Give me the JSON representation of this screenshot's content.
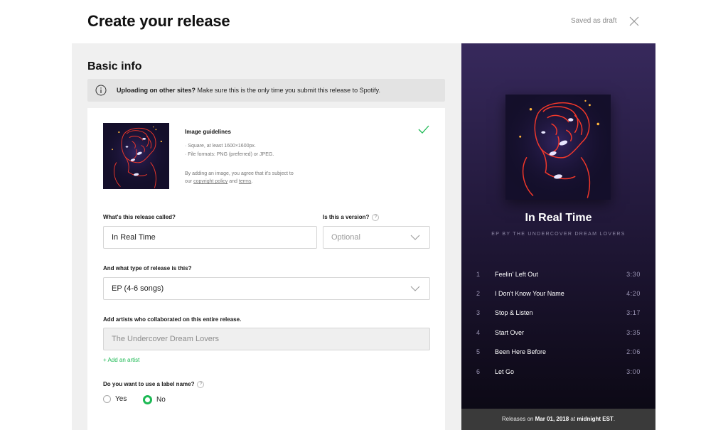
{
  "header": {
    "title": "Create your release",
    "saved_status": "Saved as draft"
  },
  "basic_info": {
    "title": "Basic info",
    "notice": {
      "bold": "Uploading on other sites?",
      "text": " Make sure this is the only time you submit this release to Spotify."
    },
    "image_guidelines": {
      "title": "Image guidelines",
      "line1": "· Square, at least 1600×1600px.",
      "line2": "· File formats: PNG (preferred) or JPEG.",
      "line3": "By adding an image, you agree that it's subject to",
      "line4_prefix": "our ",
      "copyright_link": "copyright policy",
      "line4_mid": " and ",
      "terms_link": "terms",
      "line4_suffix": "."
    },
    "release_name": {
      "label": "What's this release called?",
      "value": "In Real Time"
    },
    "version": {
      "label": "Is this a version?",
      "placeholder": "Optional"
    },
    "release_type": {
      "label": "And what type of release is this?",
      "value": "EP (4-6 songs)"
    },
    "artists": {
      "label": "Add artists who collaborated on this entire release.",
      "value": "The Undercover Dream Lovers",
      "add_link": "+ Add an artist"
    },
    "label_name": {
      "label": "Do you want to use a label name?",
      "options": [
        {
          "label": "Yes",
          "checked": false
        },
        {
          "label": "No",
          "checked": true
        }
      ]
    }
  },
  "preview": {
    "title": "In Real Time",
    "subtitle": "EP BY THE UNDERCOVER DREAM LOVERS",
    "tracks": [
      {
        "num": "1",
        "name": "Feelin' Left Out",
        "duration": "3:30"
      },
      {
        "num": "2",
        "name": "I Don't Know Your Name",
        "duration": "4:20"
      },
      {
        "num": "3",
        "name": "Stop & Listen",
        "duration": "3:17"
      },
      {
        "num": "4",
        "name": "Start Over",
        "duration": "3:35"
      },
      {
        "num": "5",
        "name": "Been Here Before",
        "duration": "2:06"
      },
      {
        "num": "6",
        "name": "Let Go",
        "duration": "3:00"
      }
    ],
    "release_prefix": "Releases on ",
    "release_date": "Mar 01, 2018",
    "release_mid": " at ",
    "release_time": "midnight EST",
    "release_suffix": "."
  },
  "colors": {
    "accent": "#1db954",
    "preview_bg_top": "#37295c",
    "preview_bg_bottom": "#0a0812",
    "neon": "#ff3a2a"
  }
}
